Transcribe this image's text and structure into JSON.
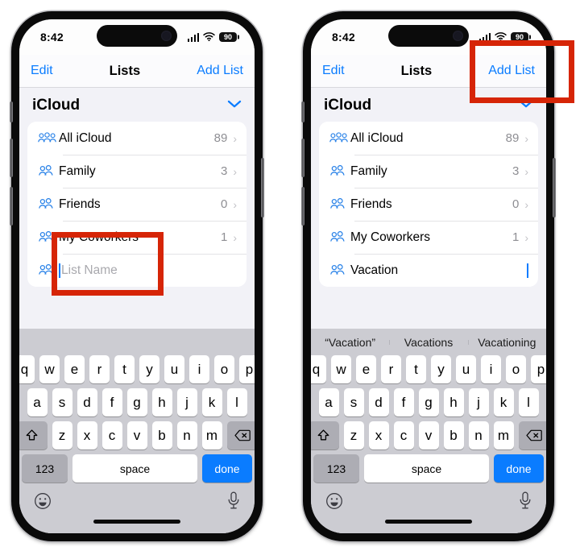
{
  "meta": {
    "annotation_color": "#d62507",
    "accent_blue": "#0a7cff"
  },
  "status_bar": {
    "time": "8:42",
    "cell_icon": "cellular-signal-icon",
    "wifi_icon": "wifi-icon",
    "battery_level": "90"
  },
  "nav": {
    "left_label": "Edit",
    "title": "Lists",
    "right_label": "Add List"
  },
  "section": {
    "title": "iCloud",
    "collapse_icon": "chevron-down-icon"
  },
  "rows": [
    {
      "icon": "group-of-people-icon",
      "label": "All iCloud",
      "count": "89",
      "chevron": "›"
    },
    {
      "icon": "two-people-icon",
      "label": "Family",
      "count": "3",
      "chevron": "›"
    },
    {
      "icon": "two-people-icon",
      "label": "Friends",
      "count": "0",
      "chevron": "›"
    },
    {
      "icon": "two-people-icon",
      "label": "My Coworkers",
      "count": "1",
      "chevron": "›"
    }
  ],
  "new_list_row": {
    "icon": "two-people-icon",
    "placeholder": "List Name",
    "typed_value": "Vacation"
  },
  "predictions_right": [
    "“Vacation”",
    "Vacations",
    "Vacationing"
  ],
  "keyboard": {
    "row1": [
      "q",
      "w",
      "e",
      "r",
      "t",
      "y",
      "u",
      "i",
      "o",
      "p"
    ],
    "row2": [
      "a",
      "s",
      "d",
      "f",
      "g",
      "h",
      "j",
      "k",
      "l"
    ],
    "row3": [
      "z",
      "x",
      "c",
      "v",
      "b",
      "n",
      "m"
    ],
    "shift_icon": "shift-arrow-icon",
    "delete_icon": "delete-backward-icon",
    "numbers_label": "123",
    "space_label": "space",
    "return_label": "done",
    "emoji_icon": "emoji-smiley-icon",
    "dictation_icon": "microphone-icon"
  },
  "annotations": {
    "left": {
      "target": "list-name-field",
      "shape": "rectangle"
    },
    "right": {
      "target": "add-list-button",
      "shape": "rectangle"
    }
  }
}
